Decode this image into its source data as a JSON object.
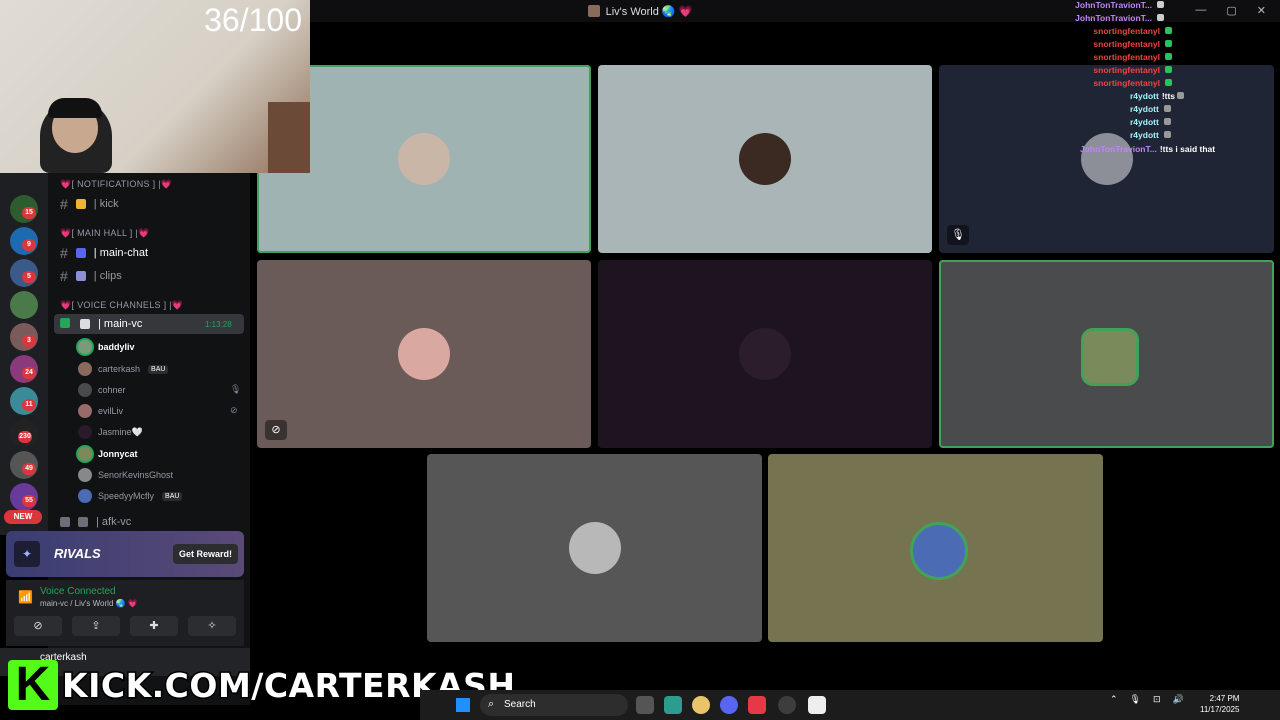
{
  "window": {
    "title": "Liv's World 🌏 💗",
    "controls": [
      "—",
      "▢",
      "✕"
    ]
  },
  "stream_overlay": {
    "counter": "36/100",
    "kick_url": "KICK.COM/CARTERKASH",
    "kick_logo": "K"
  },
  "server_rail": {
    "badges": [
      "15",
      "9",
      "5",
      "3",
      "24",
      "11",
      "230",
      "49",
      "55"
    ],
    "new_label": "NEW"
  },
  "channels": {
    "cat_notifications": "💗[ NOTIFICATIONS ] |💗",
    "kick": "| kick",
    "cat_main_hall": "💗[ MAIN HALL ] |💗",
    "main_chat": "| main-chat",
    "clips": "| clips",
    "cat_voice": "💗[ VOICE CHANNELS ] |💗",
    "main_vc": "| main-vc",
    "main_vc_time": "1:13:28",
    "afk_vc": "| afk-vc",
    "members": [
      {
        "name": "baddyliv",
        "tag": ""
      },
      {
        "name": "carterkash",
        "tag": "BAU"
      },
      {
        "name": "cohner",
        "tag": ""
      },
      {
        "name": "evilLiv",
        "tag": ""
      },
      {
        "name": "Jasmine🤍",
        "tag": ""
      },
      {
        "name": "Jonnycat",
        "tag": ""
      },
      {
        "name": "SenorKevinsGhost",
        "tag": ""
      },
      {
        "name": "SpeedyyMcfly",
        "tag": "BAU"
      }
    ]
  },
  "promo": {
    "name": "RIVALS",
    "button": "Get Reward!"
  },
  "voice": {
    "status": "Voice Connected",
    "path": "main-vc / Liv's World 🌏 💗"
  },
  "user": {
    "name": "carterkash"
  },
  "chat": [
    {
      "user": "JohnTonTravionT...",
      "msg": "",
      "color": "#c084fc"
    },
    {
      "user": "JohnTonTravionT...",
      "msg": "",
      "color": "#c084fc"
    },
    {
      "user": "snortingfentanyl",
      "msg": "",
      "color": "#ef4444"
    },
    {
      "user": "snortingfentanyl",
      "msg": "",
      "color": "#ef4444"
    },
    {
      "user": "snortingfentanyl",
      "msg": "",
      "color": "#ef4444"
    },
    {
      "user": "snortingfentanyl",
      "msg": "",
      "color": "#ef4444"
    },
    {
      "user": "snortingfentanyl",
      "msg": "",
      "color": "#ef4444"
    },
    {
      "user": "r4ydott",
      "msg": "!tts",
      "color": "#a5f3fc"
    },
    {
      "user": "r4ydott",
      "msg": "",
      "color": "#a5f3fc"
    },
    {
      "user": "r4ydott",
      "msg": "",
      "color": "#a5f3fc"
    },
    {
      "user": "r4ydott",
      "msg": "",
      "color": "#a5f3fc"
    },
    {
      "user": "JohnTonTravionT...",
      "msg": "!tts i said that",
      "color": "#c084fc"
    }
  ],
  "taskbar": {
    "search": "Search",
    "time": "2:47 PM",
    "date": "11/17/2025"
  },
  "colors": {
    "speaking": "#43a25a",
    "kick_green": "#53fc18"
  }
}
